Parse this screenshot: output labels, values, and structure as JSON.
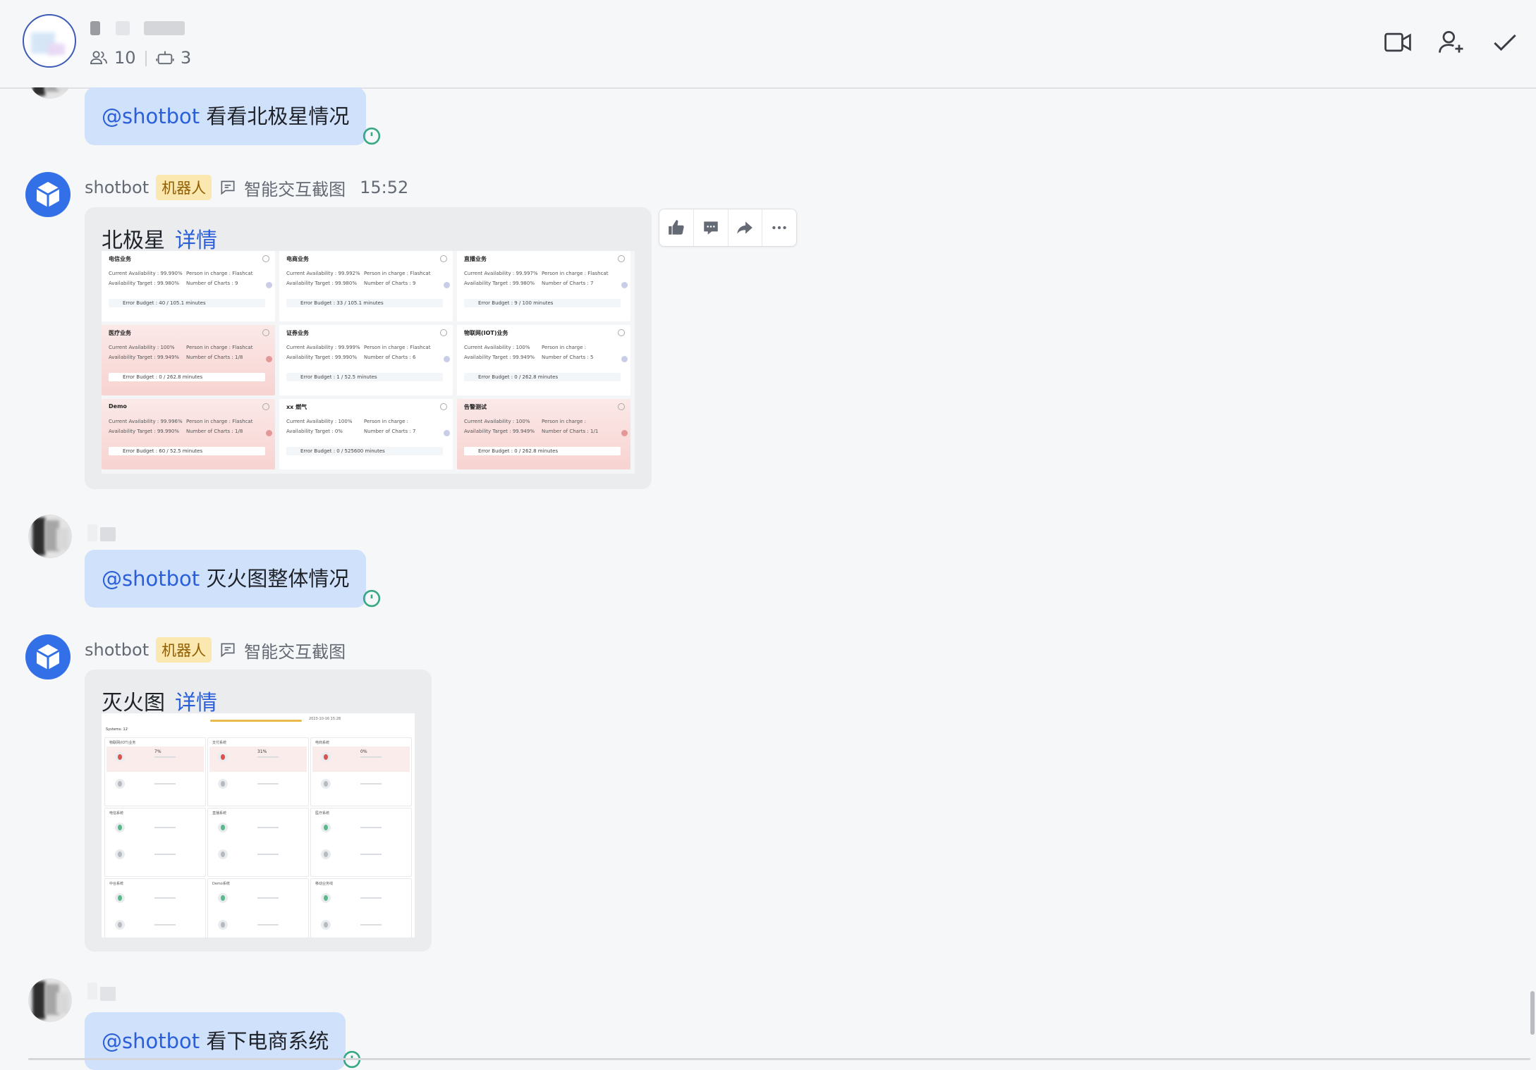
{
  "header": {
    "member_count": "10",
    "bot_count": "3",
    "icons": [
      "video-call-icon",
      "add-member-icon",
      "done-check-icon"
    ]
  },
  "messages": [
    {
      "type": "user",
      "mention": "@shotbot",
      "text": "看看北极星情况"
    },
    {
      "type": "bot",
      "sender": "shotbot",
      "tag": "机器人",
      "source": "智能交互截图",
      "time": "15:52",
      "card_title": "北极星",
      "card_link": "详情"
    },
    {
      "type": "user",
      "mention": "@shotbot",
      "text": "灭火图整体情况"
    },
    {
      "type": "bot",
      "sender": "shotbot",
      "tag": "机器人",
      "source": "智能交互截图",
      "card_title": "灭火图",
      "card_link": "详情"
    },
    {
      "type": "user",
      "mention": "@shotbot",
      "text": "看下电商系统"
    }
  ],
  "polaris": {
    "labels": {
      "current": "Current Availability : ",
      "target": "Availability Target : ",
      "person": "Person in charge : ",
      "charts": "Number of Charts : ",
      "budget": "Error Budget : "
    },
    "cards": [
      {
        "name": "电信业务",
        "current": "99.990%",
        "target": "99.980%",
        "person": "Flashcat",
        "charts": "9",
        "budget": "40 / 105.1 minutes",
        "alert": false
      },
      {
        "name": "电商业务",
        "current": "99.992%",
        "target": "99.980%",
        "person": "Flashcat",
        "charts": "9",
        "budget": "33 / 105.1 minutes",
        "alert": false
      },
      {
        "name": "直播业务",
        "current": "99.997%",
        "target": "99.980%",
        "person": "Flashcat",
        "charts": "7",
        "budget": "9 / 100 minutes",
        "alert": false
      },
      {
        "name": "医疗业务",
        "current": "100%",
        "target": "99.949%",
        "person": "Flashcat",
        "charts": "1/8",
        "budget": "0 / 262.8 minutes",
        "alert": true
      },
      {
        "name": "证券业务",
        "current": "99.999%",
        "target": "99.990%",
        "person": "Flashcat",
        "charts": "6",
        "budget": "1 / 52.5 minutes",
        "alert": false
      },
      {
        "name": "物联网(IOT)业务",
        "current": "100%",
        "target": "99.949%",
        "person": "",
        "charts": "5",
        "budget": "0 / 262.8 minutes",
        "alert": false
      },
      {
        "name": "Demo",
        "current": "99.996%",
        "target": "99.990%",
        "person": "Flashcat",
        "charts": "1/8",
        "budget": "60 / 52.5 minutes",
        "alert": true
      },
      {
        "name": "xx 燃气",
        "current": "100%",
        "target": "0%",
        "person": "",
        "charts": "7",
        "budget": "0 / 525600 minutes",
        "alert": false
      },
      {
        "name": "告警测试",
        "current": "100%",
        "target": "99.949%",
        "person": "",
        "charts": "1/1",
        "budget": "0 / 262.8 minutes",
        "alert": true
      }
    ]
  },
  "firemap": {
    "systems_label": "Systems: 12",
    "date_text": "2023-10-16 15:28",
    "cells": [
      {
        "name": "物联网(IOT)业务",
        "pct": "7%",
        "alert": true
      },
      {
        "name": "支付系统",
        "pct": "31%",
        "alert": true
      },
      {
        "name": "电商系统",
        "pct": "0%",
        "alert": true
      },
      {
        "name": "电信系统",
        "pct": "",
        "alert": false
      },
      {
        "name": "直播系统",
        "pct": "",
        "alert": false
      },
      {
        "name": "医疗系统",
        "pct": "",
        "alert": false
      },
      {
        "name": "中台系统",
        "pct": "",
        "alert": false
      },
      {
        "name": "Demo系统",
        "pct": "",
        "alert": false
      },
      {
        "name": "移动业务线",
        "pct": "",
        "alert": false
      }
    ]
  }
}
